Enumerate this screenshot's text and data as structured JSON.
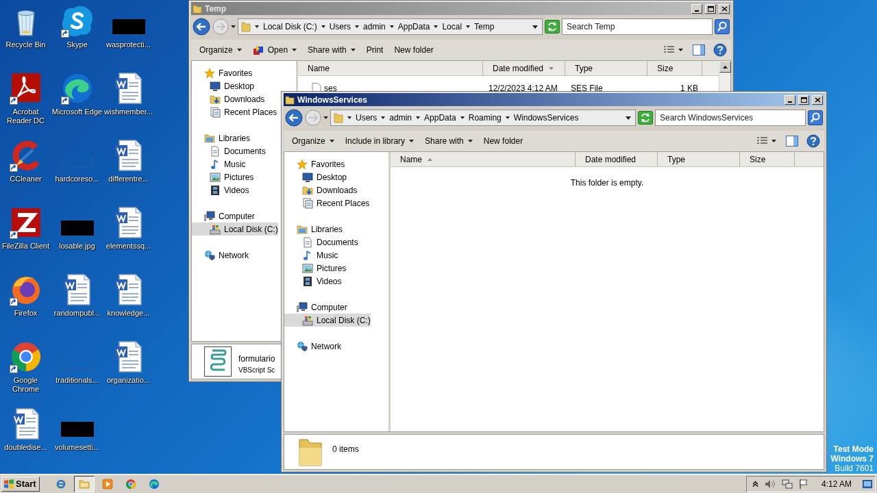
{
  "desktop": {
    "icons": [
      {
        "label": "Recycle Bin",
        "kind": "recycle",
        "shortcut": false
      },
      {
        "label": "Acrobat Reader DC",
        "kind": "acrobat",
        "shortcut": true
      },
      {
        "label": "CCleaner",
        "kind": "ccleaner",
        "shortcut": true
      },
      {
        "label": "FileZilla Client",
        "kind": "filezilla",
        "shortcut": true
      },
      {
        "label": "Firefox",
        "kind": "firefox",
        "shortcut": true
      },
      {
        "label": "Google Chrome",
        "kind": "chrome",
        "shortcut": true
      },
      {
        "label": "doubledise...",
        "kind": "word",
        "shortcut": false
      },
      {
        "label": "Skype",
        "kind": "skype",
        "shortcut": true
      },
      {
        "label": "Microsoft Edge",
        "kind": "edge",
        "shortcut": true
      },
      {
        "label": "hardcoreso...",
        "kind": "blank",
        "shortcut": false
      },
      {
        "label": "losable.jpg",
        "kind": "redacted",
        "shortcut": false
      },
      {
        "label": "randompubl...",
        "kind": "word",
        "shortcut": false
      },
      {
        "label": "traditionals...",
        "kind": "blank",
        "shortcut": false
      },
      {
        "label": "volumesetti...",
        "kind": "redacted",
        "shortcut": false
      },
      {
        "label": "wasprotecti...",
        "kind": "redacted",
        "shortcut": false
      },
      {
        "label": "wishmember...",
        "kind": "word",
        "shortcut": false
      },
      {
        "label": "differentre...",
        "kind": "word",
        "shortcut": false
      },
      {
        "label": "elementssq...",
        "kind": "word",
        "shortcut": false
      },
      {
        "label": "knowledge...",
        "kind": "word",
        "shortcut": false
      },
      {
        "label": "organizatio...",
        "kind": "word",
        "shortcut": false
      }
    ],
    "os_notice": [
      {
        "text": "Test Mode",
        "kind": "heading"
      },
      {
        "text": "Windows 7",
        "kind": "heading"
      },
      {
        "text": "Build 7601",
        "kind": "build"
      }
    ]
  },
  "windows": [
    {
      "title": "Temp",
      "active": false,
      "back_enabled": true,
      "forward_enabled": false,
      "address": [
        "Local Disk (C:)",
        "Users",
        "admin",
        "AppData",
        "Local",
        "Temp"
      ],
      "search": {
        "placeholder": "Search Temp"
      },
      "toolbar": [
        {
          "label": "Organize",
          "dropdown": true,
          "has_icon": false
        },
        {
          "label": "Open",
          "dropdown": true,
          "has_icon": true
        },
        {
          "label": "Share with",
          "dropdown": true,
          "has_icon": false
        },
        {
          "label": "Print",
          "dropdown": false,
          "has_icon": false
        },
        {
          "label": "New folder",
          "dropdown": false,
          "has_icon": false
        }
      ],
      "sidebar": [
        {
          "label": "Favorites",
          "kind": "favorites",
          "selected": false,
          "children": [
            {
              "label": "Desktop",
              "kind": "desktop",
              "selected": false
            },
            {
              "label": "Downloads",
              "kind": "downloads",
              "selected": false
            },
            {
              "label": "Recent Places",
              "kind": "recent",
              "selected": false
            }
          ]
        },
        {
          "label": "Libraries",
          "kind": "libraries",
          "selected": false,
          "children": [
            {
              "label": "Documents",
              "kind": "documents",
              "selected": false
            },
            {
              "label": "Music",
              "kind": "music",
              "selected": false
            },
            {
              "label": "Pictures",
              "kind": "pictures",
              "selected": false
            },
            {
              "label": "Videos",
              "kind": "videos",
              "selected": false
            }
          ]
        },
        {
          "label": "Computer",
          "kind": "computer",
          "selected": false,
          "children": [
            {
              "label": "Local Disk (C:)",
              "kind": "disk",
              "selected": true
            }
          ]
        },
        {
          "label": "Network",
          "kind": "network",
          "selected": false
        }
      ],
      "columns": [
        {
          "label": "Name",
          "sorted": false
        },
        {
          "label": "Date modified",
          "sorted": true,
          "descending": true
        },
        {
          "label": "Type",
          "sorted": false
        },
        {
          "label": "Size",
          "sorted": false
        }
      ],
      "rows": [
        {
          "name": "ses",
          "date_modified": "12/2/2023 4:12 AM",
          "type": "SES File",
          "size": "1 KB"
        }
      ],
      "details": {
        "kind": "script",
        "title": "formulario",
        "subtitle": "VBScript Sc"
      }
    },
    {
      "title": "WindowsServices",
      "active": true,
      "back_enabled": true,
      "forward_enabled": false,
      "address": [
        "Users",
        "admin",
        "AppData",
        "Roaming",
        "WindowsServices"
      ],
      "search": {
        "placeholder": "Search WindowsServices"
      },
      "toolbar": [
        {
          "label": "Organize",
          "dropdown": true,
          "has_icon": false
        },
        {
          "label": "Include in library",
          "dropdown": true,
          "has_icon": false
        },
        {
          "label": "Share with",
          "dropdown": true,
          "has_icon": false
        },
        {
          "label": "New folder",
          "dropdown": false,
          "has_icon": false
        }
      ],
      "sidebar": [
        {
          "label": "Favorites",
          "kind": "favorites",
          "selected": false,
          "children": [
            {
              "label": "Desktop",
              "kind": "desktop",
              "selected": false
            },
            {
              "label": "Downloads",
              "kind": "downloads",
              "selected": false
            },
            {
              "label": "Recent Places",
              "kind": "recent",
              "selected": false
            }
          ]
        },
        {
          "label": "Libraries",
          "kind": "libraries",
          "selected": false,
          "children": [
            {
              "label": "Documents",
              "kind": "documents",
              "selected": false
            },
            {
              "label": "Music",
              "kind": "music",
              "selected": false
            },
            {
              "label": "Pictures",
              "kind": "pictures",
              "selected": false
            },
            {
              "label": "Videos",
              "kind": "videos",
              "selected": false
            }
          ]
        },
        {
          "label": "Computer",
          "kind": "computer",
          "selected": false,
          "children": [
            {
              "label": "Local Disk (C:)",
              "kind": "disk",
              "selected": true
            }
          ]
        },
        {
          "label": "Network",
          "kind": "network",
          "selected": false
        }
      ],
      "columns": [
        {
          "label": "Name",
          "sorted": true,
          "descending": false
        },
        {
          "label": "Date modified",
          "sorted": false
        },
        {
          "label": "Type",
          "sorted": false
        },
        {
          "label": "Size",
          "sorted": false
        }
      ],
      "empty_message": "This folder is empty.",
      "details": {
        "kind": "folder",
        "title": "0 items"
      }
    }
  ],
  "taskbar": {
    "start_label": "Start",
    "apps": [
      {
        "kind": "ie",
        "active": false
      },
      {
        "kind": "explorer",
        "active": true
      },
      {
        "kind": "media",
        "active": false
      },
      {
        "kind": "chrome",
        "active": false
      },
      {
        "kind": "edge",
        "active": false
      }
    ],
    "clock": "4:12 AM"
  }
}
